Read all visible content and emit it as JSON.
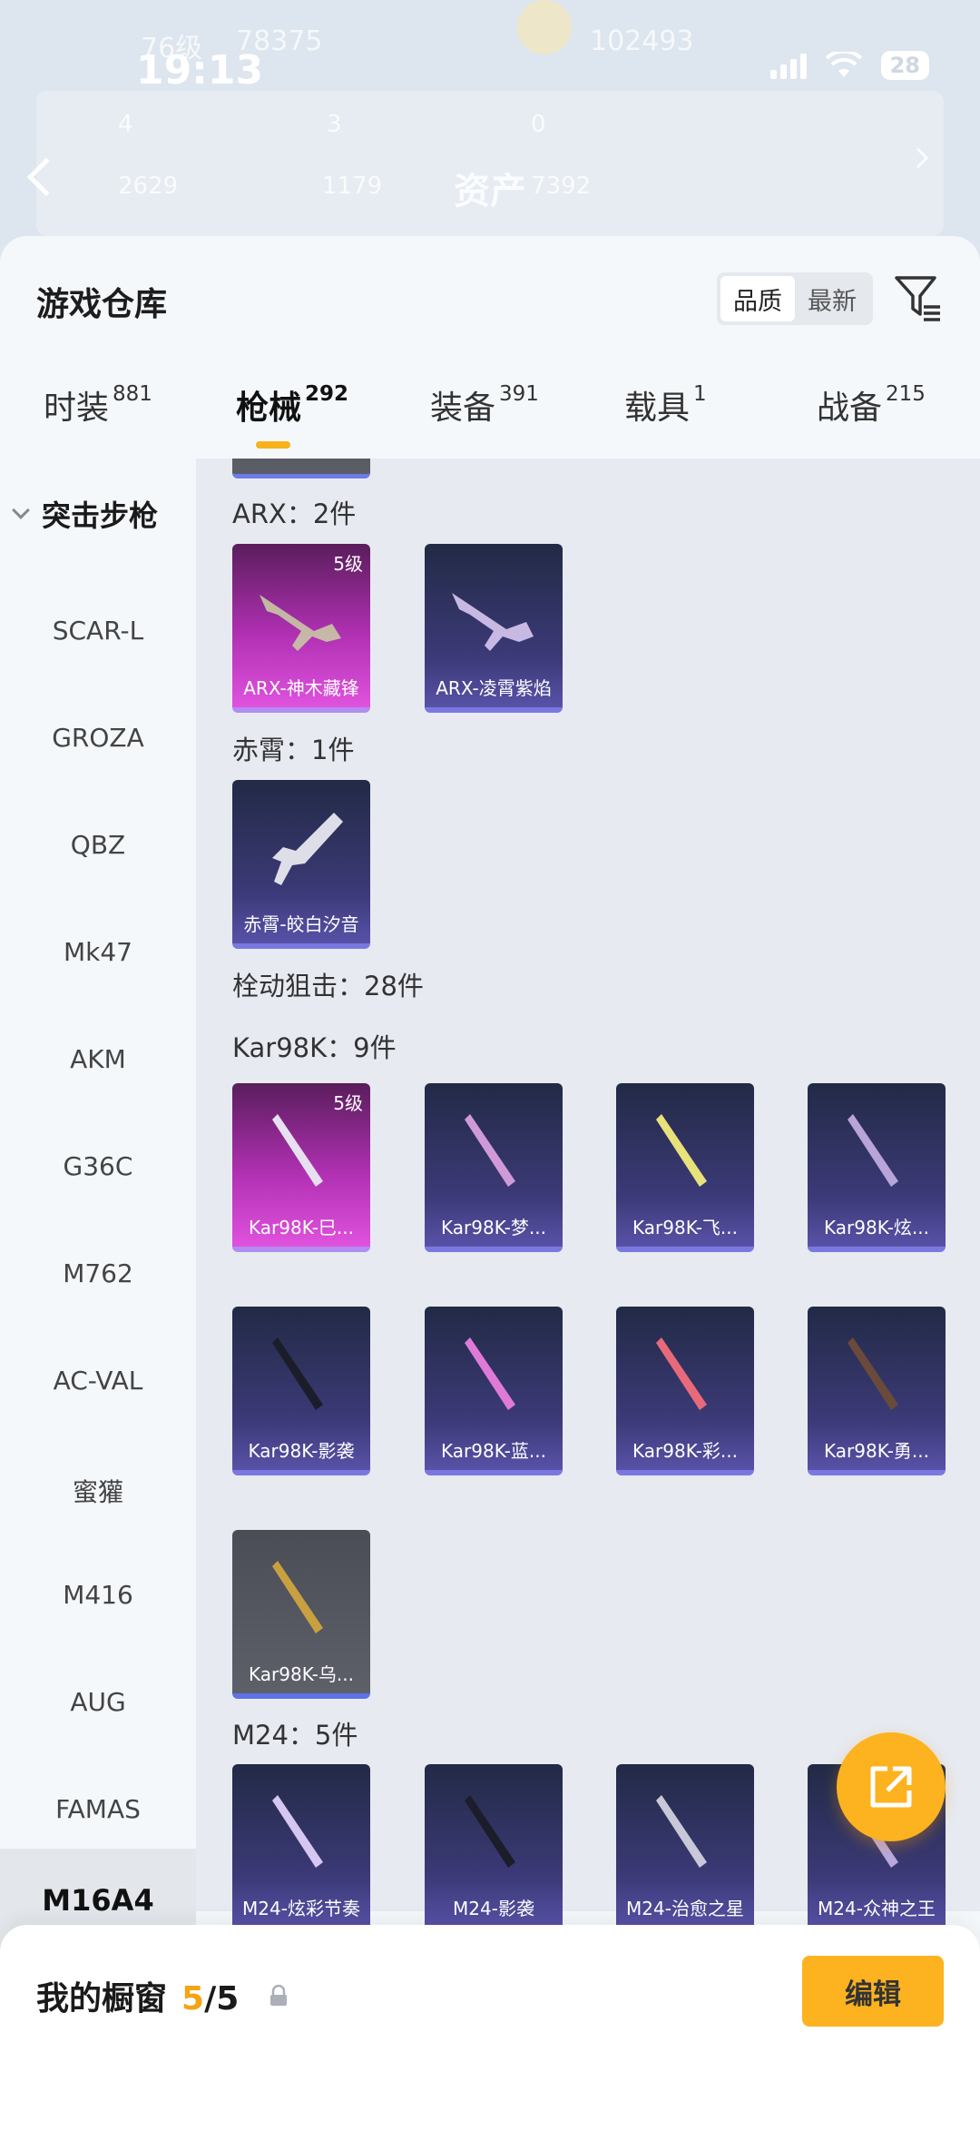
{
  "status_bar": {
    "time": "19:13",
    "battery": "28"
  },
  "background": {
    "level": "76级",
    "points": "78375",
    "points2": "102493",
    "stat1": "4",
    "stat2": "3",
    "stat3": "0",
    "stat4": "2629",
    "stat5": "1179",
    "asset_label": "资产",
    "asset_value": "7392"
  },
  "header": {
    "title": "游戏仓库",
    "sort_quality": "品质",
    "sort_newest": "最新",
    "filter_icon": "filter-icon"
  },
  "tabs": [
    {
      "label": "时装",
      "count": "881"
    },
    {
      "label": "枪械",
      "count": "292"
    },
    {
      "label": "装备",
      "count": "391"
    },
    {
      "label": "载具",
      "count": "1"
    },
    {
      "label": "战备",
      "count": "215"
    }
  ],
  "sidebar": {
    "category": "突击步枪",
    "items": [
      "SCAR-L",
      "GROZA",
      "QBZ",
      "Mk47",
      "AKM",
      "G36C",
      "M762",
      "AC-VAL",
      "蜜獾",
      "M416",
      "AUG",
      "FAMAS",
      "M16A4"
    ]
  },
  "content": {
    "sections": [
      {
        "label": "ARX：2件"
      },
      {
        "label": "赤霄：1件"
      },
      {
        "label": "栓动狙击：28件"
      },
      {
        "label": "Kar98K：9件"
      },
      {
        "label": "M24：5件"
      }
    ],
    "arx_cards": [
      {
        "name": "ARX-神木藏锋",
        "level": "5级"
      },
      {
        "name": "ARX-凌霄紫焰"
      }
    ],
    "chixiao_cards": [
      {
        "name": "赤霄-皎白汐音"
      }
    ],
    "kar_cards": [
      {
        "name": "Kar98K-巳...",
        "level": "5级"
      },
      {
        "name": "Kar98K-梦..."
      },
      {
        "name": "Kar98K-飞..."
      },
      {
        "name": "Kar98K-炫..."
      },
      {
        "name": "Kar98K-影袭"
      },
      {
        "name": "Kar98K-蓝..."
      },
      {
        "name": "Kar98K-彩..."
      },
      {
        "name": "Kar98K-勇..."
      },
      {
        "name": "Kar98K-乌..."
      }
    ],
    "m24_cards": [
      {
        "name": "M24-炫彩节奏"
      },
      {
        "name": "M24-影袭"
      },
      {
        "name": "M24-治愈之星"
      },
      {
        "name": "M24-众神之王"
      }
    ]
  },
  "showcase": {
    "title": "我的橱窗",
    "count": "5",
    "total": "/5",
    "edit_label": "编辑"
  },
  "colors": {
    "accent": "#fdb21f",
    "purple_card": "#3c3a78",
    "pink_card": "#b030b2"
  }
}
